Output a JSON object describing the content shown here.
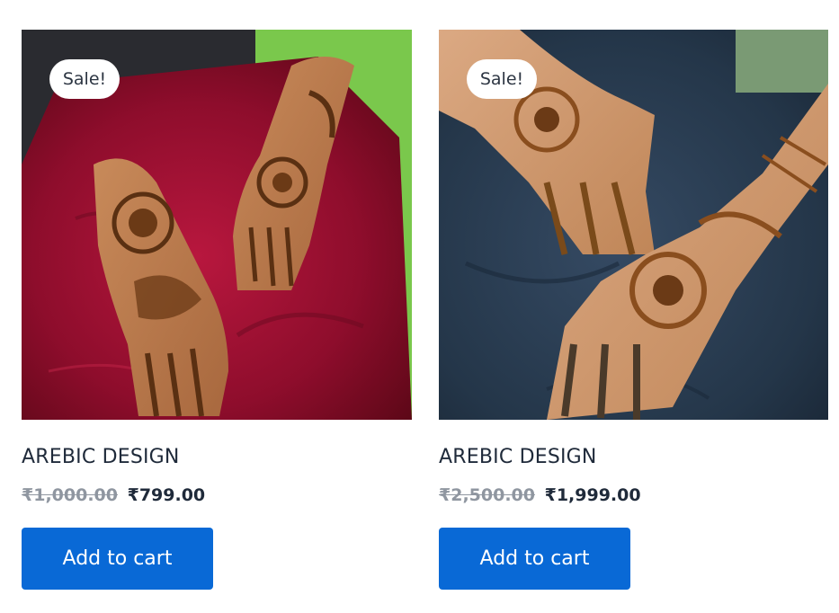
{
  "products": [
    {
      "badge": "Sale!",
      "title": "AREBIC DESIGN",
      "price_old": "₹1,000.00",
      "price_new": "₹799.00",
      "button_label": "Add to cart",
      "image_alt": "mehndi-hands-on-red-velvet"
    },
    {
      "badge": "Sale!",
      "title": "AREBIC DESIGN",
      "price_old": "₹2,500.00",
      "price_new": "₹1,999.00",
      "button_label": "Add to cart",
      "image_alt": "mehndi-hands-on-navy-cloth"
    }
  ],
  "colors": {
    "button_bg": "#0969d6",
    "title": "#1f2a3a",
    "old_price": "#8f96a0"
  }
}
